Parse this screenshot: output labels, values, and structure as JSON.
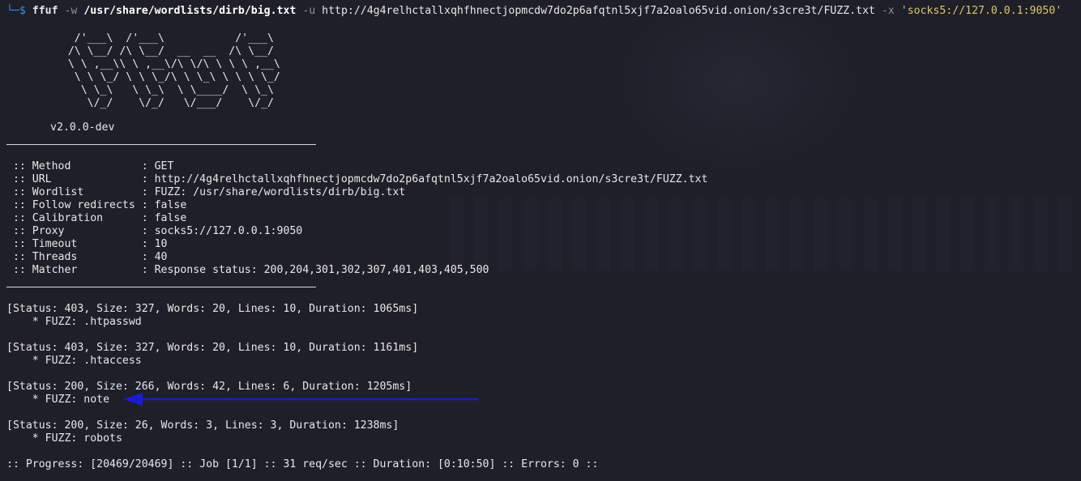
{
  "command": {
    "prompt_symbol": "└─$",
    "program": "ffuf",
    "flag_w": "-w",
    "wordlist": "/usr/share/wordlists/dirb/big.txt",
    "flag_u": "-u",
    "url": "http://4g4relhctallxqhfhnectjopmcdw7do2p6afqtnl5xjf7a2oalo65vid.onion/s3cre3t/FUZZ.txt",
    "flag_x": "-x",
    "proxy": "'socks5://127.0.0.1:9050'"
  },
  "banner": {
    "ascii_art": "    /'___\\  /'___\\           /'___\\\n   /\\ \\__/ /\\ \\__/  __  __  /\\ \\__/\n   \\ \\ ,__\\\\ \\ ,__\\/\\ \\/\\ \\ \\ \\ ,__\\\n    \\ \\ \\_/ \\ \\ \\_/\\ \\ \\_\\ \\ \\ \\ \\_/\n     \\ \\_\\   \\ \\_\\  \\ \\____/  \\ \\_\\\n      \\/_/    \\/_/   \\/___/    \\/_/",
    "version": "v2.0.0-dev"
  },
  "config": [
    " :: Method           : GET",
    " :: URL              : http://4g4relhctallxqhfhnectjopmcdw7do2p6afqtnl5xjf7a2oalo65vid.onion/s3cre3t/FUZZ.txt",
    " :: Wordlist         : FUZZ: /usr/share/wordlists/dirb/big.txt",
    " :: Follow redirects : false",
    " :: Calibration      : false",
    " :: Proxy            : socks5://127.0.0.1:9050",
    " :: Timeout          : 10",
    " :: Threads          : 40",
    " :: Matcher          : Response status: 200,204,301,302,307,401,403,405,500"
  ],
  "results": [
    {
      "status": "[Status: 403, Size: 327, Words: 20, Lines: 10, Duration: 1065ms]",
      "fuzz": "    * FUZZ: .htpasswd"
    },
    {
      "status": "[Status: 403, Size: 327, Words: 20, Lines: 10, Duration: 1161ms]",
      "fuzz": "    * FUZZ: .htaccess"
    },
    {
      "status": "[Status: 200, Size: 266, Words: 42, Lines: 6, Duration: 1205ms]",
      "fuzz": "    * FUZZ: note"
    },
    {
      "status": "[Status: 200, Size: 26, Words: 3, Lines: 3, Duration: 1238ms]",
      "fuzz": "    * FUZZ: robots"
    }
  ],
  "progress": ":: Progress: [20469/20469] :: Job [1/1] :: 31 req/sec :: Duration: [0:10:50] :: Errors: 0 ::",
  "colors": {
    "background": "#1e1f29",
    "prompt": "#3b8eea",
    "string_arg": "#e0c46c",
    "arrow": "#1a1ad6"
  }
}
